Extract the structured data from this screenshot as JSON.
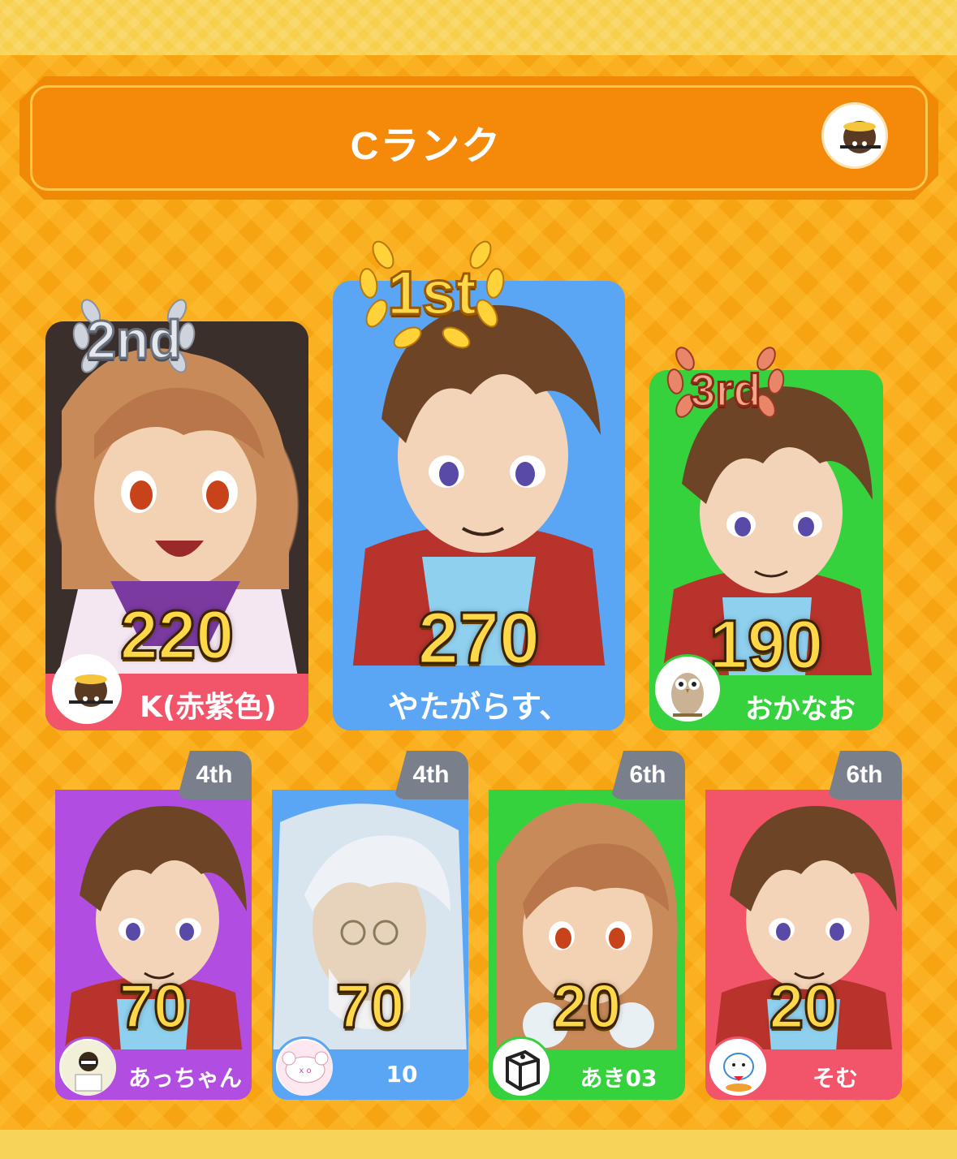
{
  "header": {
    "title": "Cランク"
  },
  "podium": [
    {
      "place_label": "2nd",
      "score": "220",
      "name": "K(赤紫色)",
      "bar_color": "#f2556a",
      "art_bg": "#3a2f2a"
    },
    {
      "place_label": "1st",
      "score": "270",
      "name": "やたがらす、",
      "bar_color": "#5aa6f5",
      "art_bg": "#5aa6f5"
    },
    {
      "place_label": "3rd",
      "score": "190",
      "name": "おかなお",
      "bar_color": "#36d23e",
      "art_bg": "#36d23e"
    }
  ],
  "others": [
    {
      "place_label": "4th",
      "score": "70",
      "name": "あっちゃん",
      "bar_color": "#b14de0",
      "art_bg": "#b14de0"
    },
    {
      "place_label": "4th",
      "score": "70",
      "name": "10",
      "bar_color": "#5aa6f5",
      "art_bg": "#5aa6f5"
    },
    {
      "place_label": "6th",
      "score": "20",
      "name": "あき03",
      "bar_color": "#36d23e",
      "art_bg": "#36d23e"
    },
    {
      "place_label": "6th",
      "score": "20",
      "name": "そむ",
      "bar_color": "#f2556a",
      "art_bg": "#f2556a"
    }
  ],
  "colors": {
    "gold": "#ffd84a",
    "silver": "#d8dde6",
    "bronze": "#d86a4a"
  }
}
